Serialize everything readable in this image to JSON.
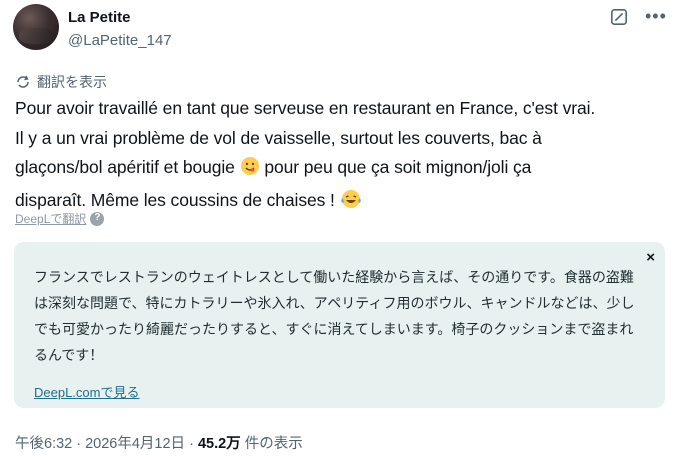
{
  "author": {
    "name": "La Petite",
    "handle": "@LaPetite_147"
  },
  "translate_link": "翻訳を表示",
  "tweet": {
    "line1": "Pour avoir travaillé en tant que serveuse en restaurant en France, c'est vrai.",
    "line2": "Il y a un vrai problème de vol de vaisselle, surtout les couverts, bac à",
    "line3_a": "glaçons/bol apéritif et bougie ",
    "line3_b": " pour peu que ça soit mignon/joli ça",
    "line4": "disparaît. Même les coussins de chaises ! ",
    "emoji1": "face-savoring-food-emoji",
    "emoji2": "tears-of-joy-emoji"
  },
  "translated_by": "DeepLで翻訳",
  "translation_box": {
    "text": "フランスでレストランのウェイトレスとして働いた経験から言えば、その通りです。食器の盗難は深刻な問題で、特にカトラリーや氷入れ、アペリティフ用のボウル、キャンドルなどは、少しでも可愛かったり綺麗だったりすると、すぐに消えてしまいます。椅子のクッションまで盗まれるんです！",
    "link": "DeepL.comで見る",
    "close": "×"
  },
  "meta": {
    "time": "午後6:32 · 2026年4月12日 · ",
    "views": "45.2万",
    "views_suffix": " 件の表示"
  },
  "colors": {
    "box_bg": "#e6f1f0",
    "secondary": "#536471",
    "link": "#1f6f8b"
  }
}
